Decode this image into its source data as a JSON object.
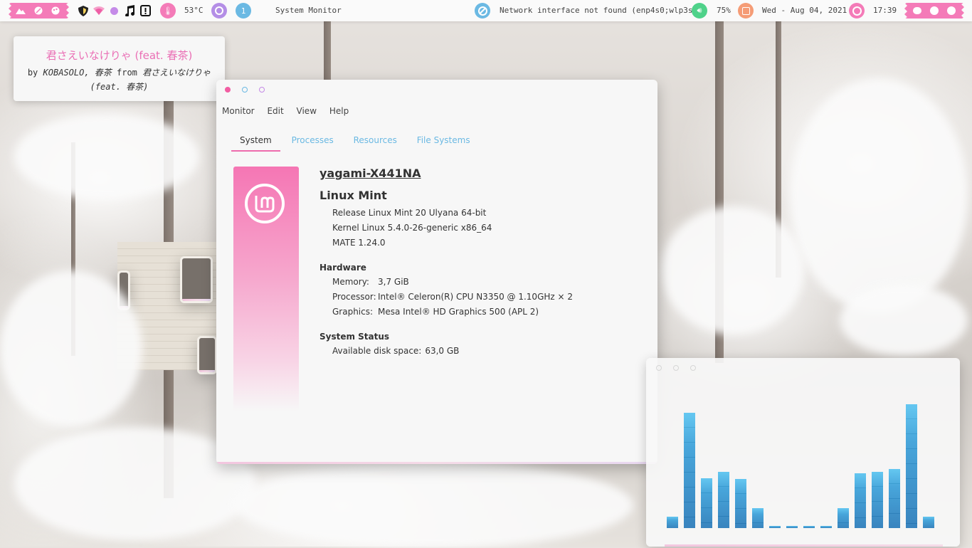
{
  "panel": {
    "temperature": "53°C",
    "workspace_number": "1",
    "active_window": "System Monitor",
    "network_status": "Network interface not found (enp4s0;wlp3s0)",
    "volume": "75%",
    "date": "Wed - Aug 04, 2021",
    "time": "17:39",
    "icons": [
      "mountain-icon",
      "leaf-icon",
      "palette-icon",
      "shield-icon",
      "wifi-icon",
      "dot-icon",
      "music-note-icon",
      "alert-icon",
      "thermometer-icon",
      "clock-icon",
      "no-network-icon",
      "speaker-icon",
      "calendar-icon",
      "clock-icon",
      "toggle-icon",
      "smiley-icon",
      "power-icon"
    ],
    "accent": "#f47bb8",
    "accent_secondary": "#b48ee6",
    "info_color": "#6bb9e3",
    "positive_color": "#4fd28a",
    "warning_color": "#f59c76"
  },
  "now_playing": {
    "title": "君さえいなけりゃ (feat. 春茶)",
    "by_word": "by",
    "artist": "KOBASOLO, 春茶",
    "from_word": "from",
    "album": "君さえいなけりゃ (feat. 春茶)"
  },
  "monitor": {
    "menu": [
      "Monitor",
      "Edit",
      "View",
      "Help"
    ],
    "tabs": [
      "System",
      "Processes",
      "Resources",
      "File Systems"
    ],
    "active_tab": "System",
    "hostname": "yagami-X441NA",
    "distro": "Linux Mint",
    "release": "Release Linux Mint 20 Ulyana 64-bit",
    "kernel": "Kernel Linux 5.4.0-26-generic x86_64",
    "desktop": "MATE 1.24.0",
    "hardware_heading": "Hardware",
    "memory_label": "Memory:",
    "memory_value": "3,7 GiB",
    "processor_label": "Processor:",
    "processor_value": "Intel® Celeron(R) CPU N3350 @ 1.10GHz × 2",
    "graphics_label": "Graphics:",
    "graphics_value": "Mesa Intel® HD Graphics 500 (APL 2)",
    "status_heading": "System Status",
    "disk_label": "Available disk space:",
    "disk_value": "63,0 GB"
  },
  "visualizer": {
    "bar_levels": [
      0.09,
      0.92,
      0.4,
      0.45,
      0.39,
      0.16,
      0.01,
      0.01,
      0.01,
      0.01,
      0.16,
      0.44,
      0.45,
      0.47,
      0.99,
      0.09
    ],
    "bar_color": "#3a9fd8"
  }
}
